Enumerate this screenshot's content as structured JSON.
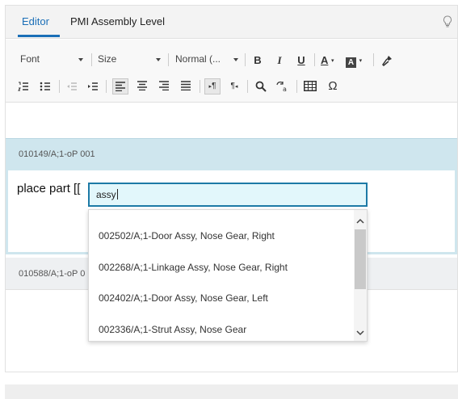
{
  "tabs": [
    {
      "label": "Editor",
      "active": true
    },
    {
      "label": "PMI Assembly Level",
      "active": false
    }
  ],
  "toolbar": {
    "font_label": "Font",
    "size_label": "Size",
    "style_label": "Normal (...",
    "bold": "B",
    "italic": "I",
    "underline": "U",
    "text_color": "A",
    "bg_color": "A",
    "pilcrow": "¶",
    "omega": "Ω"
  },
  "sections": [
    {
      "id": "010149/A;1-oP 001",
      "body_text": "place part [["
    },
    {
      "id": "010588/A;1-oP 0"
    }
  ],
  "search": {
    "value": "assy"
  },
  "options": [
    "002502/A;1-Door Assy, Nose Gear, Right",
    "002268/A;1-Linkage Assy, Nose Gear, Right",
    "002402/A;1-Door Assy, Nose Gear, Left",
    "002336/A;1-Strut Assy, Nose Gear"
  ],
  "colors": {
    "accent": "#1b6fb7",
    "focus_border": "#1d7aa6",
    "section_header": "#cfe6ee"
  }
}
